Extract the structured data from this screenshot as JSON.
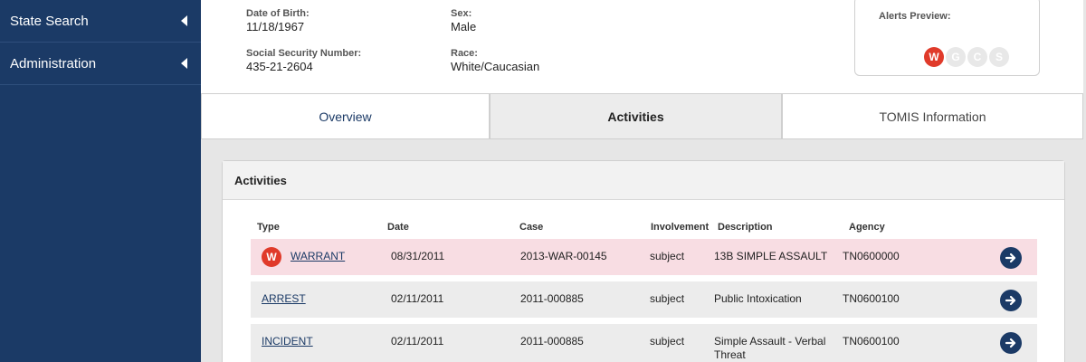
{
  "sidebar": {
    "items": [
      {
        "label": "State Search"
      },
      {
        "label": "Administration"
      }
    ]
  },
  "person": {
    "dob_label": "Date of Birth:",
    "dob": "11/18/1967",
    "ssn_label": "Social Security Number:",
    "ssn": "435-21-2604",
    "sex_label": "Sex:",
    "sex": "Male",
    "race_label": "Race:",
    "race": "White/Caucasian"
  },
  "alerts": {
    "title": "Alerts Preview:",
    "badges": [
      {
        "letter": "W",
        "active": true,
        "color": "#e03a2a"
      },
      {
        "letter": "G",
        "active": false,
        "color": "#e8e8e8"
      },
      {
        "letter": "C",
        "active": false,
        "color": "#e8e8e8"
      },
      {
        "letter": "S",
        "active": false,
        "color": "#e8e8e8"
      }
    ]
  },
  "tabs": [
    {
      "label": "Overview",
      "active": false
    },
    {
      "label": "Activities",
      "active": true
    },
    {
      "label": "TOMIS Information",
      "active": false
    }
  ],
  "activities": {
    "title": "Activities",
    "columns": [
      "Type",
      "Date",
      "Case",
      "Involvement",
      "Description",
      "Agency"
    ],
    "rows": [
      {
        "badge": "W",
        "type": "WARRANT",
        "date": "08/31/2011",
        "case": "2013-WAR-00145",
        "involvement": "subject",
        "description": "13B SIMPLE ASSAULT",
        "agency": "TN0600000",
        "highlight": true
      },
      {
        "badge": "",
        "type": "ARREST",
        "date": "02/11/2011",
        "case": "2011-000885",
        "involvement": "subject",
        "description": "Public Intoxication",
        "agency": "TN0600100",
        "highlight": false
      },
      {
        "badge": "",
        "type": "INCIDENT",
        "date": "02/11/2011",
        "case": "2011-000885",
        "involvement": "subject",
        "description": "Simple Assault - Verbal Threat",
        "agency": "TN0600100",
        "highlight": false
      }
    ]
  },
  "colors": {
    "sidebar": "#1b3a66",
    "warrant_red": "#e03a2a",
    "warrant_row": "#f8dde3",
    "row": "#ececec"
  }
}
